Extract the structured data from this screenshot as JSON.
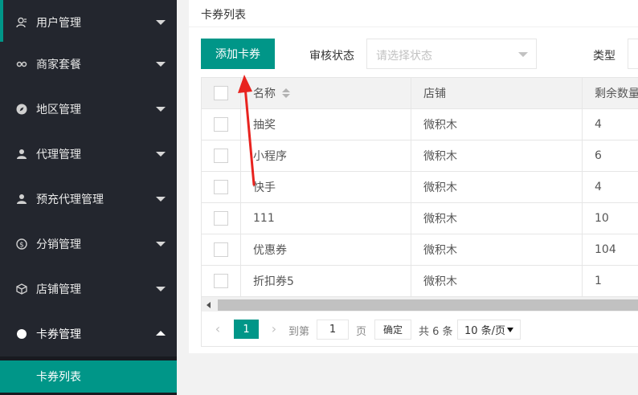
{
  "sidebar": {
    "items": [
      {
        "label": "用户管理",
        "icon": "user-icon"
      },
      {
        "label": "商家套餐",
        "icon": "link-icon"
      },
      {
        "label": "地区管理",
        "icon": "compass-icon"
      },
      {
        "label": "代理管理",
        "icon": "person-icon"
      },
      {
        "label": "预充代理管理",
        "icon": "person-icon"
      },
      {
        "label": "分销管理",
        "icon": "dollar-icon"
      },
      {
        "label": "店铺管理",
        "icon": "cube-icon"
      },
      {
        "label": "卡券管理",
        "icon": "circle-icon"
      }
    ],
    "sub_items": [
      {
        "label": "卡券列表"
      }
    ]
  },
  "main": {
    "card_title": "卡券列表",
    "add_button": "添加卡券",
    "filters": {
      "status_label": "审核状态",
      "status_placeholder": "请选择状态",
      "type_label": "类型"
    },
    "table": {
      "headers": [
        "名称",
        "店铺",
        "剩余数量"
      ],
      "rows": [
        [
          "抽奖",
          "微积木",
          "4"
        ],
        [
          "小程序",
          "微积木",
          "6"
        ],
        [
          "快手",
          "微积木",
          "4"
        ],
        [
          "111",
          "微积木",
          "10"
        ],
        [
          "优惠券",
          "微积木",
          "104"
        ],
        [
          "折扣券5",
          "微积木",
          "1"
        ]
      ]
    },
    "pager": {
      "current_page": "1",
      "goto_label": "到第",
      "goto_value": "1",
      "page_unit": "页",
      "confirm": "确定",
      "total": "共 6 条",
      "page_size": "10 条/页"
    }
  },
  "colors": {
    "accent": "#009688",
    "sidebar_bg": "#23262e",
    "annotation": "#e8231f"
  }
}
